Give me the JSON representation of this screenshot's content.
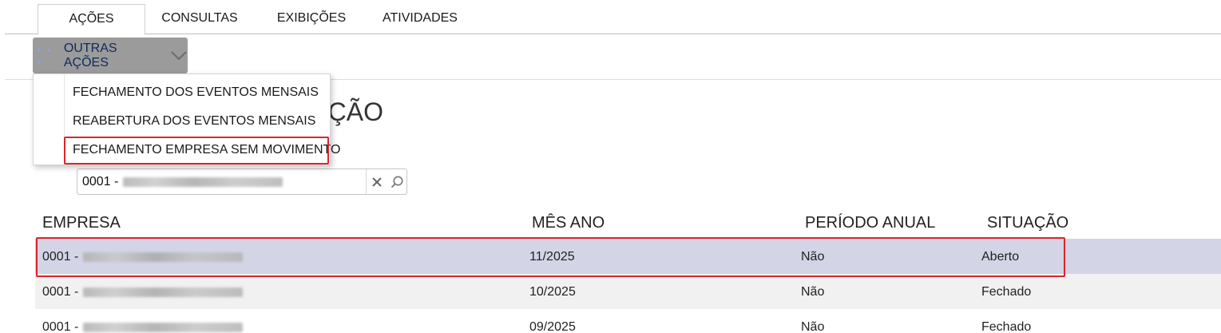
{
  "tabs": [
    {
      "label": "AÇÕES",
      "active": true
    },
    {
      "label": "CONSULTAS",
      "active": false
    },
    {
      "label": "EXIBIÇÕES",
      "active": false
    },
    {
      "label": "ATIVIDADES",
      "active": false
    }
  ],
  "toolbar": {
    "outras_acoes_label": "OUTRAS AÇÕES",
    "outras_acoes_dots": "• • •"
  },
  "menu": {
    "items": [
      {
        "label": "FECHAMENTO DOS EVENTOS MENSAIS"
      },
      {
        "label": "REABERTURA DOS EVENTOS MENSAIS"
      },
      {
        "label": "FECHAMENTO EMPRESA SEM MOVIMENTO",
        "highlighted": true
      }
    ]
  },
  "page": {
    "title_visible": "ÇÃO"
  },
  "filter": {
    "value_prefix": "0001 -"
  },
  "table": {
    "headers": [
      "EMPRESA",
      "MÊS ANO",
      "PERÍODO ANUAL",
      "SITUAÇÃO"
    ],
    "rows": [
      {
        "empresa": "0001 -",
        "mes_ano": "11/2025",
        "periodo_anual": "Não",
        "situacao": "Aberto",
        "selected": true
      },
      {
        "empresa": "0001 -",
        "mes_ano": "10/2025",
        "periodo_anual": "Não",
        "situacao": "Fechado"
      },
      {
        "empresa": "0001 -",
        "mes_ano": "09/2025",
        "periodo_anual": "Não",
        "situacao": "Fechado"
      }
    ]
  },
  "colors": {
    "selected_row": "#d3d4e6",
    "alt_row": "#f1f1f1",
    "button_bg": "#9b9b9b",
    "highlight": "#d9262b"
  },
  "icons": {
    "chevron": "chevron-down-icon",
    "clear": "close-icon",
    "search": "search-icon"
  }
}
